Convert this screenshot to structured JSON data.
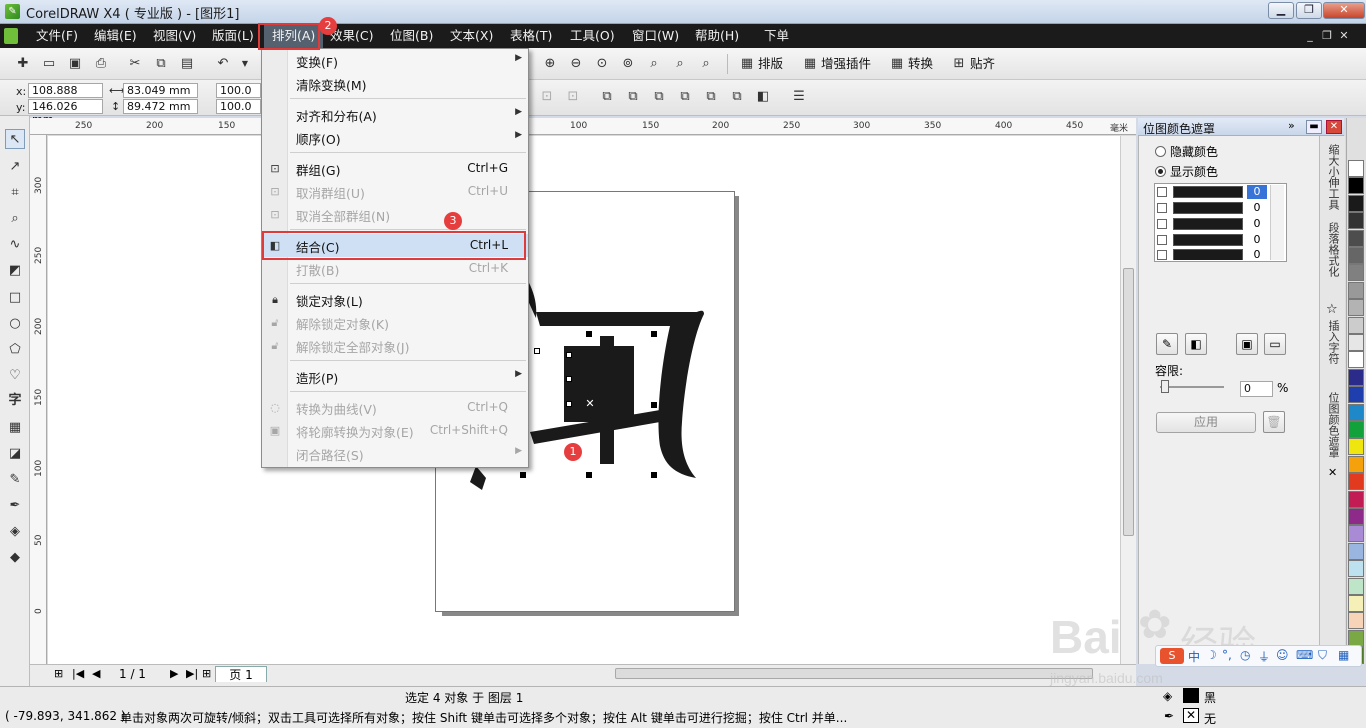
{
  "window": {
    "title": "CorelDRAW X4 ( 专业版 ) - [图形1]"
  },
  "menubar": {
    "items": [
      {
        "label": "文件(F)"
      },
      {
        "label": "编辑(E)"
      },
      {
        "label": "视图(V)"
      },
      {
        "label": "版面(L)"
      },
      {
        "label": "排列(A)"
      },
      {
        "label": "效果(C)"
      },
      {
        "label": "位图(B)"
      },
      {
        "label": "文本(X)"
      },
      {
        "label": "表格(T)"
      },
      {
        "label": "工具(O)"
      },
      {
        "label": "窗口(W)"
      },
      {
        "label": "帮助(H)"
      },
      {
        "label": "下单"
      }
    ]
  },
  "toolbar1": {
    "text_buttons": [
      {
        "label": "排版"
      },
      {
        "label": "增强插件"
      },
      {
        "label": "转换"
      },
      {
        "label": "贴齐"
      }
    ]
  },
  "property_bar": {
    "x_label": "x:",
    "x_value": "108.888 mm",
    "y_label": "y:",
    "y_value": "146.026 mm",
    "width_value": "83.049 mm",
    "height_value": "89.472 mm",
    "scale_w": "100.0",
    "scale_h": "100.0"
  },
  "ruler_top_ticks": [
    "250",
    "200",
    "150",
    "100",
    "150",
    "200",
    "250",
    "300",
    "350",
    "400",
    "450",
    "毫米"
  ],
  "ruler_left_ticks": [
    "300",
    "250",
    "200",
    "150",
    "100",
    "50",
    "0"
  ],
  "dropdown": {
    "items": [
      {
        "label": "变换(F)",
        "shortcut": "",
        "submenu": true,
        "disabled": false
      },
      {
        "label": "清除变换(M)",
        "shortcut": "",
        "submenu": false,
        "disabled": false
      },
      {
        "label": "对齐和分布(A)",
        "shortcut": "",
        "submenu": true,
        "disabled": false
      },
      {
        "label": "顺序(O)",
        "shortcut": "",
        "submenu": true,
        "disabled": false
      },
      {
        "label": "群组(G)",
        "shortcut": "Ctrl+G",
        "submenu": false,
        "disabled": false
      },
      {
        "label": "取消群组(U)",
        "shortcut": "Ctrl+U",
        "submenu": false,
        "disabled": true
      },
      {
        "label": "取消全部群组(N)",
        "shortcut": "",
        "submenu": false,
        "disabled": true
      },
      {
        "label": "结合(C)",
        "shortcut": "Ctrl+L",
        "submenu": false,
        "disabled": false
      },
      {
        "label": "打散(B)",
        "shortcut": "Ctrl+K",
        "submenu": false,
        "disabled": true
      },
      {
        "label": "锁定对象(L)",
        "shortcut": "",
        "submenu": false,
        "disabled": false
      },
      {
        "label": "解除锁定对象(K)",
        "shortcut": "",
        "submenu": false,
        "disabled": true
      },
      {
        "label": "解除锁定全部对象(J)",
        "shortcut": "",
        "submenu": false,
        "disabled": true
      },
      {
        "label": "造形(P)",
        "shortcut": "",
        "submenu": true,
        "disabled": false
      },
      {
        "label": "转换为曲线(V)",
        "shortcut": "Ctrl+Q",
        "submenu": false,
        "disabled": true
      },
      {
        "label": "将轮廓转换为对象(E)",
        "shortcut": "Ctrl+Shift+Q",
        "submenu": false,
        "disabled": true
      },
      {
        "label": "闭合路径(S)",
        "shortcut": "",
        "submenu": true,
        "disabled": true
      }
    ]
  },
  "annotations": {
    "badge1": "1",
    "badge2": "2",
    "badge3": "3"
  },
  "docker": {
    "title": "位图颜色遮罩",
    "radio_hide": "隐藏颜色",
    "radio_show": "显示颜色",
    "color_values": [
      "0",
      "0",
      "0",
      "0",
      "0"
    ],
    "tolerance_label": "容限:",
    "tolerance_value": "0",
    "tolerance_unit": "%",
    "apply_label": "应用"
  },
  "side_tabs": [
    "缩大小伸工具",
    "段落格式化",
    "插入字符",
    "位图颜色遮罩"
  ],
  "pagebar": {
    "page_count": "1 / 1",
    "page_tab": "页 1"
  },
  "status": {
    "selection": "选定 4 对象 于 图层 1",
    "coords": "( -79.893, 341.862 )",
    "hint": "单击对象两次可旋转/倾斜；双击工具可选择所有对象；按住 Shift 键单击可选择多个对象；按住 Alt 键单击可进行挖掘；按住 Ctrl 并单...",
    "fill_label": "黑",
    "outline_label": "无"
  },
  "palette_colors": [
    "#ffffff",
    "#000000",
    "#1a1a1a",
    "#333333",
    "#4d4d4d",
    "#666666",
    "#808080",
    "#999999",
    "#b3b3b3",
    "#cccccc",
    "#e6e6e6",
    "#ffffff",
    "#2b2b8a",
    "#1f3fae",
    "#1e88c9",
    "#12a13a",
    "#f0e60f",
    "#f5a10c",
    "#e23a1e",
    "#c21c55",
    "#8e2a8a",
    "#a88bd4",
    "#9ab6e0",
    "#bde1ef",
    "#bfe5c8",
    "#f4f0b8",
    "#f7d4b8",
    "#7aa845",
    "#4e7a2a"
  ],
  "watermark": {
    "text_main": "Bai",
    "text_cn": "经验",
    "url": "jingyan.baidu.com"
  }
}
